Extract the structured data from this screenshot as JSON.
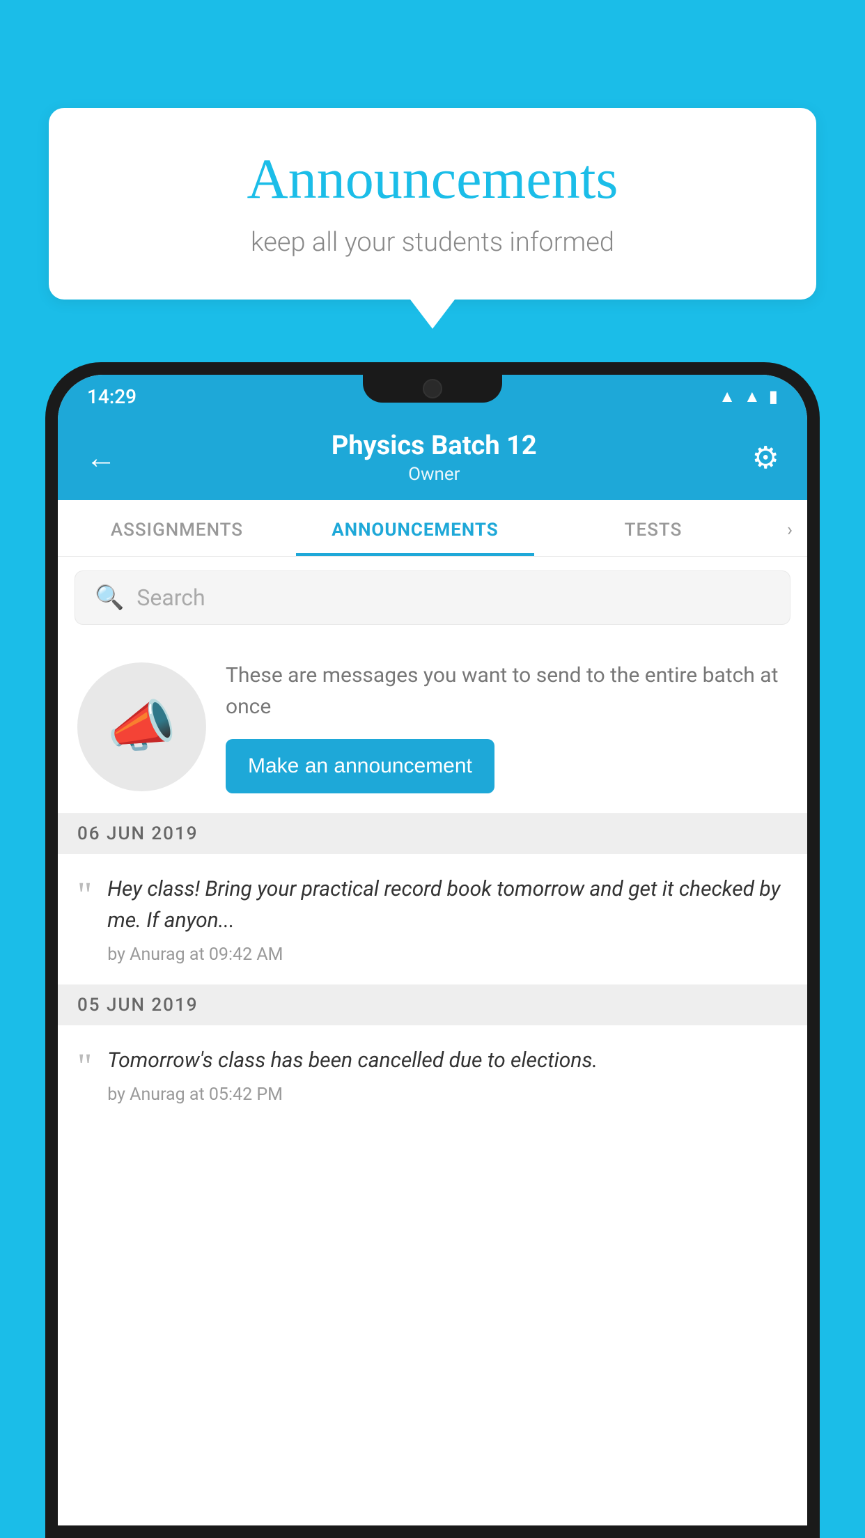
{
  "background_color": "#1BBDE8",
  "speech_bubble": {
    "title": "Announcements",
    "subtitle": "keep all your students informed"
  },
  "status_bar": {
    "time": "14:29",
    "icons": [
      "wifi",
      "signal",
      "battery"
    ]
  },
  "app_header": {
    "back_label": "←",
    "title": "Physics Batch 12",
    "subtitle": "Owner",
    "settings_label": "⚙"
  },
  "tabs": [
    {
      "label": "ASSIGNMENTS",
      "active": false
    },
    {
      "label": "ANNOUNCEMENTS",
      "active": true
    },
    {
      "label": "TESTS",
      "active": false
    }
  ],
  "search": {
    "placeholder": "Search"
  },
  "announcement_prompt": {
    "description": "These are messages you want to send to the entire batch at once",
    "button_label": "Make an announcement"
  },
  "announcements": [
    {
      "date": "06  JUN  2019",
      "text": "Hey class! Bring your practical record book tomorrow and get it checked by me. If anyon...",
      "meta": "by Anurag at 09:42 AM"
    },
    {
      "date": "05  JUN  2019",
      "text": "Tomorrow's class has been cancelled due to elections.",
      "meta": "by Anurag at 05:42 PM"
    }
  ]
}
